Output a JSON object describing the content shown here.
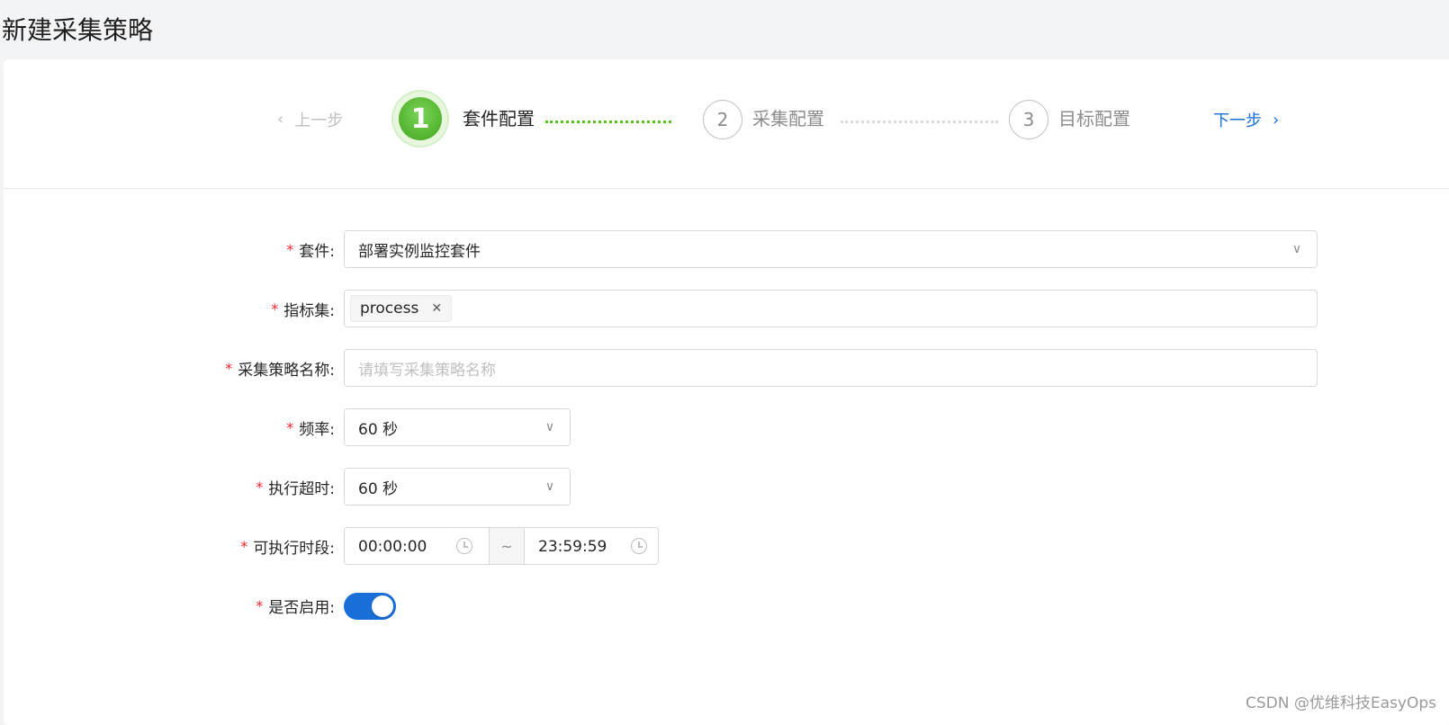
{
  "page": {
    "title": "新建采集策略"
  },
  "steps": {
    "prev_label": "上一步",
    "next_label": "下一步",
    "items": [
      {
        "number": "1",
        "label": "套件配置",
        "status": "active"
      },
      {
        "number": "2",
        "label": "采集配置",
        "status": "pending"
      },
      {
        "number": "3",
        "label": "目标配置",
        "status": "pending"
      }
    ]
  },
  "form": {
    "suite": {
      "label": "套件:",
      "value": "部署实例监控套件"
    },
    "metric_set": {
      "label": "指标集:",
      "tags": [
        "process"
      ]
    },
    "policy_name": {
      "label": "采集策略名称:",
      "value": "",
      "placeholder": "请填写采集策略名称"
    },
    "frequency": {
      "label": "频率:",
      "value": "60 秒"
    },
    "timeout": {
      "label": "执行超时:",
      "value": "60 秒"
    },
    "time_window": {
      "label": "可执行时段:",
      "start": "00:00:00",
      "separator": "~",
      "end": "23:59:59"
    },
    "enabled": {
      "label": "是否启用:",
      "value": true
    }
  },
  "watermark": "CSDN @优维科技EasyOps",
  "colors": {
    "primary": "#1a6ed8",
    "success": "#52c41a",
    "required": "#f5222d"
  }
}
